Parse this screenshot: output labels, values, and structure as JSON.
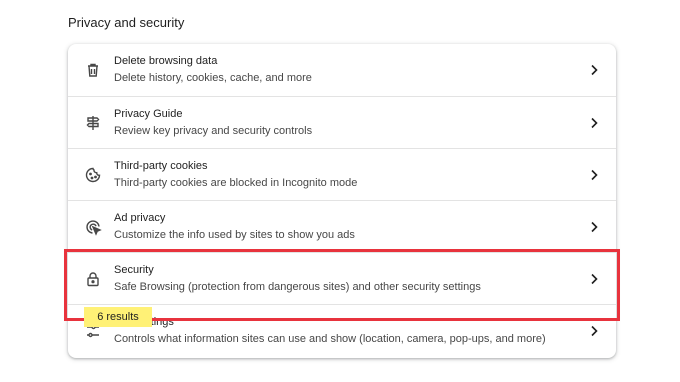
{
  "section": {
    "title": "Privacy and security"
  },
  "rows": [
    {
      "title": "Delete browsing data",
      "desc": "Delete history, cookies, cache, and more",
      "icon": "trash-icon"
    },
    {
      "title": "Privacy Guide",
      "desc": "Review key privacy and security controls",
      "icon": "signpost-icon"
    },
    {
      "title": "Third-party cookies",
      "desc": "Third-party cookies are blocked in Incognito mode",
      "icon": "cookie-icon"
    },
    {
      "title": "Ad privacy",
      "desc": "Customize the info used by sites to show you ads",
      "icon": "ad-privacy-icon"
    },
    {
      "title": "Security",
      "desc": "Safe Browsing (protection from dangerous sites) and other security settings",
      "icon": "lock-icon"
    },
    {
      "title": "Site settings",
      "desc": "Controls what information sites can use and show (location, camera, pop-ups, and more)",
      "icon": "tune-icon"
    }
  ],
  "search": {
    "results_badge": "6 results"
  },
  "colors": {
    "highlight": "#e8333d",
    "tooltip": "#fff176"
  }
}
